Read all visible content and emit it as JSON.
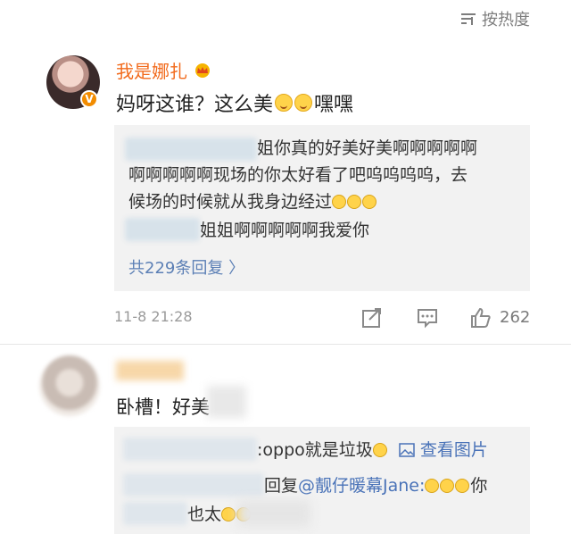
{
  "header": {
    "sort_label": "按热度"
  },
  "comment": {
    "username": "我是娜扎",
    "text_before": "妈呀这谁？这么美",
    "text_after": "嘿嘿",
    "time": "11-8 21:28",
    "likes": "262"
  },
  "replies": {
    "line1": "姐你真的好美好美啊啊啊啊啊",
    "line2": "啊啊啊啊啊现场的你太好看了吧呜呜呜呜，去",
    "line3": "候场的时候就从我身边经过",
    "line4": "姐姐啊啊啊啊啊我爱你",
    "more": "共229条回复 〉"
  },
  "comment2": {
    "text": "卧槽！好美",
    "reply1_text": ":oppo就是垃圾",
    "reply1_link": "查看图片",
    "reply2_prefix": "回复",
    "reply2_mention": "@靓仔暖幕Jane:",
    "reply2_suffix": "你",
    "reply3_text": "也太"
  },
  "icons": {
    "sort": "sort-icon",
    "crown": "crown-icon",
    "verified": "verified-badge-icon",
    "share": "share-icon",
    "comment": "comment-icon",
    "like": "thumbs-up-icon",
    "image": "image-icon"
  },
  "colors": {
    "username": "#f26b1d",
    "link": "#5b7fb5",
    "badge": "#f28c00"
  }
}
